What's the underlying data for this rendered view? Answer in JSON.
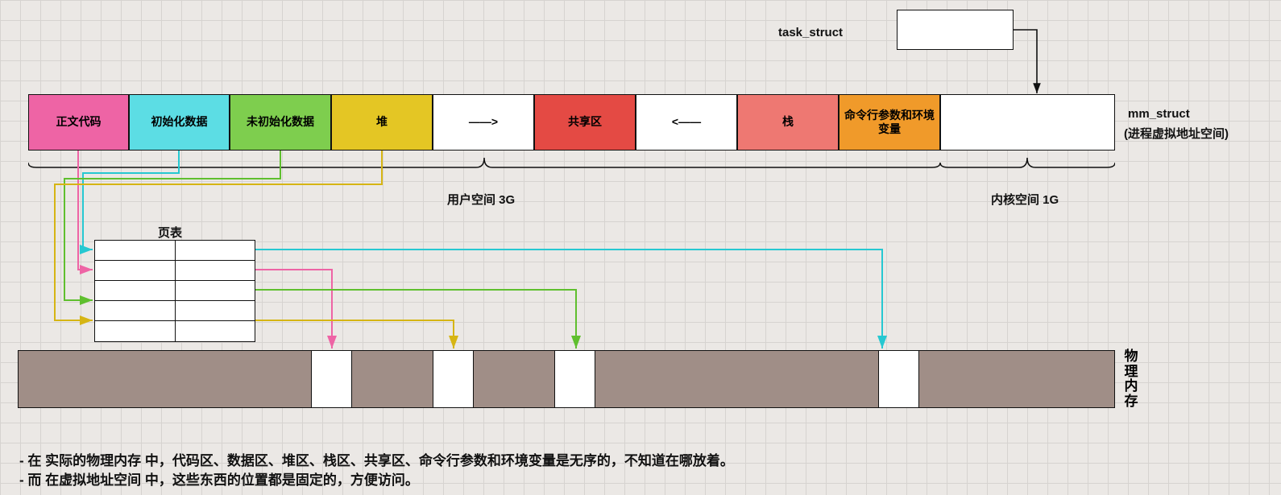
{
  "task_struct_label": "task_struct",
  "segments": {
    "text": "正文代码",
    "initdata": "初始化数据",
    "bss": "未初始化数据",
    "heap": "堆",
    "grow_right": "——>",
    "shared": "共享区",
    "grow_left": "<——",
    "stack": "栈",
    "args": "命令行参数和环境变量"
  },
  "mm_struct": {
    "line1": "mm_struct",
    "line2": "(进程虚拟地址空间)"
  },
  "brace": {
    "user": "用户空间 3G",
    "kernel": "内核空间 1G"
  },
  "page_table_label": "页表",
  "phys_mem_label": "物理内存",
  "bullets": {
    "b1": "- 在 实际的物理内存 中，代码区、数据区、堆区、栈区、共享区、命令行参数和环境变量是无序的，不知道在哪放着。",
    "b2": "- 而 在虚拟地址空间 中，这些东西的位置都是固定的，方便访问。"
  }
}
